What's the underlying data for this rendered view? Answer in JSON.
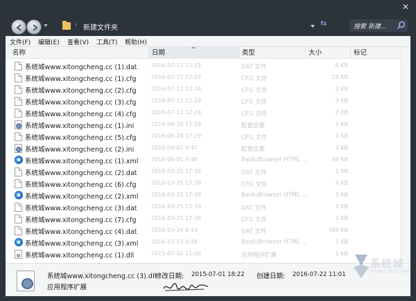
{
  "address": {
    "folder": "新建文件夹"
  },
  "search": {
    "placeholder": "搜索 新建..."
  },
  "menu": [
    "文件(F)",
    "编辑(E)",
    "查看(V)",
    "工具(T)",
    "帮助(H)"
  ],
  "columns": {
    "name": "名称",
    "date": "日期",
    "type": "类型",
    "size": "大小",
    "tag": "标记"
  },
  "files": [
    {
      "name": "系统城www.xitongcheng.cc (1).dat",
      "date": "2016-07-11 12:15",
      "type": "DAT 文件",
      "size": "6 KB",
      "icon": "doc"
    },
    {
      "name": "系统城www.xitongcheng.cc (1).cfg",
      "date": "2016-07-11 12:24",
      "type": "CFG 文件",
      "size": "14 KB",
      "icon": "doc"
    },
    {
      "name": "系统城www.xitongcheng.cc (2).cfg",
      "date": "2016-07-11 12:24",
      "type": "CFG 文件",
      "size": "2 KB",
      "icon": "doc"
    },
    {
      "name": "系统城www.xitongcheng.cc (3).cfg",
      "date": "2016-07-11 12:24",
      "type": "CFG 文件",
      "size": "3 KB",
      "icon": "doc"
    },
    {
      "name": "系统城www.xitongcheng.cc (4).cfg",
      "date": "2016-07-11 12:24",
      "type": "CFG 文件",
      "size": "2 KB",
      "icon": "doc"
    },
    {
      "name": "系统城www.xitongcheng.cc (1).ini",
      "date": "2016-06-28 17:29",
      "type": "配置设置",
      "size": "1 KB",
      "icon": "ini"
    },
    {
      "name": "系统城www.xitongcheng.cc (5).cfg",
      "date": "2016-06-28 17:29",
      "type": "CFG 文件",
      "size": "1 KB",
      "icon": "doc"
    },
    {
      "name": "系统城www.xitongcheng.cc (2).ini",
      "date": "2016-06-01 9:47",
      "type": "配置设置",
      "size": "1 KB",
      "icon": "ini"
    },
    {
      "name": "系统城www.xitongcheng.cc (1).xml",
      "date": "2016-06-01 9:46",
      "type": "BaiduBrowser HTML ...",
      "size": "49 KB",
      "icon": "xml"
    },
    {
      "name": "系统城www.xitongcheng.cc (2).dat",
      "date": "2016-03-25 17:39",
      "type": "DAT 文件",
      "size": "1 KB",
      "icon": "doc"
    },
    {
      "name": "系统城www.xitongcheng.cc (6).cfg",
      "date": "2016-03-25 17:39",
      "type": "CFG 文件",
      "size": "4 KB",
      "icon": "doc"
    },
    {
      "name": "系统城www.xitongcheng.cc (2).xml",
      "date": "2016-03-25 17:39",
      "type": "BaiduBrowser HTML ...",
      "size": "1 KB",
      "icon": "xml"
    },
    {
      "name": "系统城www.xitongcheng.cc (3).dat",
      "date": "2016-03-25 17:39",
      "type": "DAT 文件",
      "size": "1 KB",
      "icon": "doc"
    },
    {
      "name": "系统城www.xitongcheng.cc (7).cfg",
      "date": "2016-03-25 17:36",
      "type": "CFG 文件",
      "size": "1 KB",
      "icon": "doc"
    },
    {
      "name": "系统城www.xitongcheng.cc (4).dat",
      "date": "2016-03-24 8:10",
      "type": "DAT 文件",
      "size": "308 KB",
      "icon": "doc"
    },
    {
      "name": "系统城www.xitongcheng.cc (3).xml",
      "date": "2016-03-23 9:48",
      "type": "BaiduBrowser HTML ...",
      "size": "1 KB",
      "icon": "xml"
    },
    {
      "name": "系统城www.xitongcheng.cc (1).dll",
      "date": "2015-07-02 11:00",
      "type": "应用程序扩展",
      "size": "1 KB",
      "icon": "dll"
    }
  ],
  "details": {
    "name": "系统城www.xitongcheng.cc (3).dll",
    "type": "应用程序扩展",
    "modified_label": "修改日期:",
    "modified": "2015-07-01 18:22",
    "created_label": "创建日期:",
    "created": "2016-07-22 11:01"
  },
  "watermark": {
    "brand": "系统城",
    "url": "XITONGCHENG.COM"
  },
  "colors": {
    "chrome": "#2d333b",
    "accent": "#1e78d0"
  }
}
